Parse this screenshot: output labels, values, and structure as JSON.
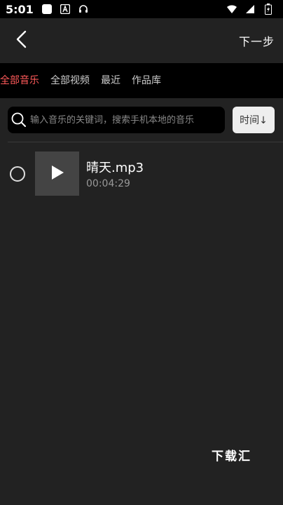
{
  "status_bar": {
    "time": "5:01",
    "icons": [
      "square-icon",
      "a-icon",
      "headset-icon",
      "wifi-icon",
      "signal-icon",
      "battery-icon"
    ]
  },
  "header": {
    "back_icon": "chevron-left-icon",
    "next_label": "下一步"
  },
  "tabs": [
    {
      "label": "全部音乐",
      "active": true
    },
    {
      "label": "全部视频",
      "active": false
    },
    {
      "label": "最近",
      "active": false
    },
    {
      "label": "作品库",
      "active": false
    }
  ],
  "search": {
    "placeholder": "输入音乐的关键词，搜索手机本地的音乐",
    "value": "",
    "sort_label": "时间↓"
  },
  "files": [
    {
      "name": "晴天.mp3",
      "duration": "00:04:29",
      "selected": false,
      "thumb_icon": "play-icon"
    }
  ],
  "watermark": "下载汇",
  "colors": {
    "background": "#222222",
    "tab_bar": "#000000",
    "active_tab": "#ff5a5a",
    "sort_button": "#eeeeee"
  }
}
